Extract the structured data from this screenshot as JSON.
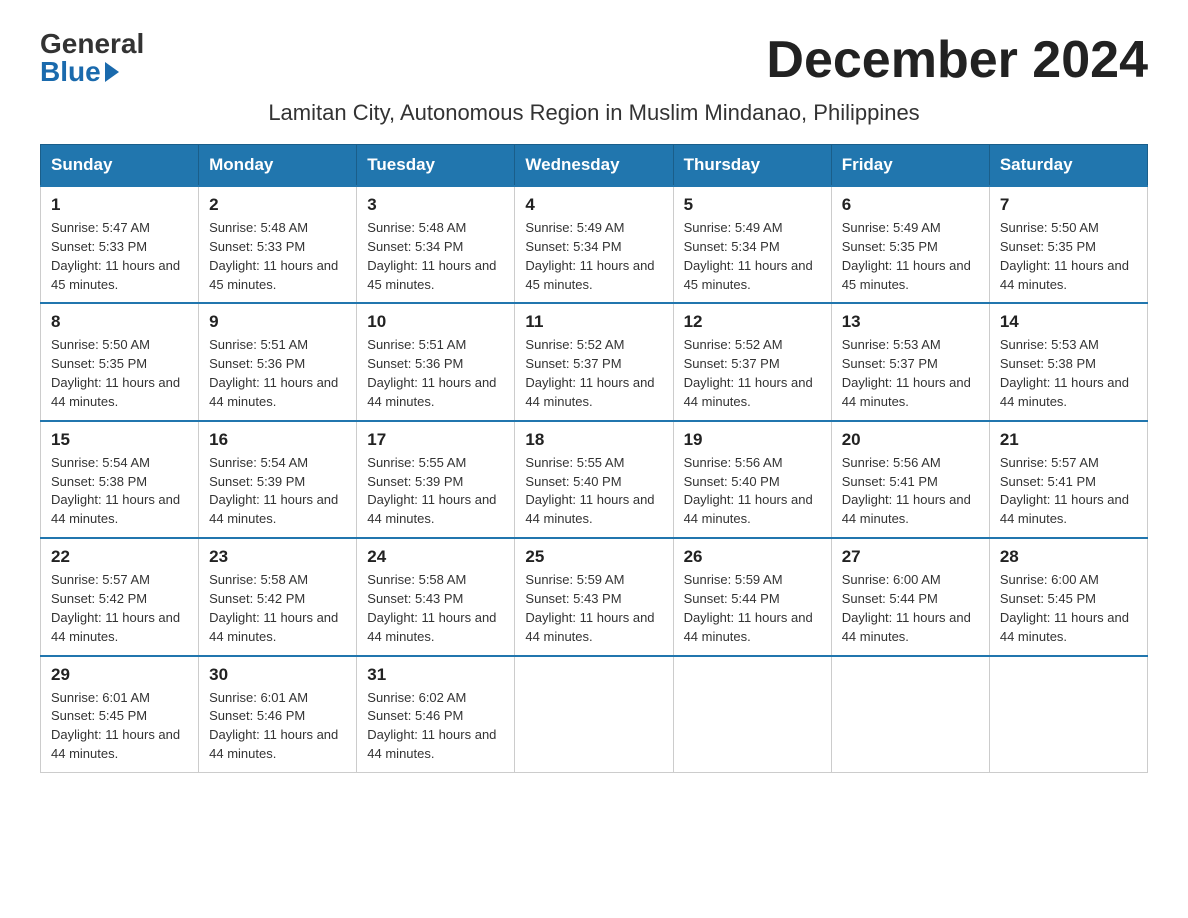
{
  "logo": {
    "general": "General",
    "blue": "Blue"
  },
  "title": "December 2024",
  "subtitle": "Lamitan City, Autonomous Region in Muslim Mindanao, Philippines",
  "weekdays": [
    "Sunday",
    "Monday",
    "Tuesday",
    "Wednesday",
    "Thursday",
    "Friday",
    "Saturday"
  ],
  "weeks": [
    [
      {
        "day": "1",
        "sunrise": "5:47 AM",
        "sunset": "5:33 PM",
        "daylight": "11 hours and 45 minutes."
      },
      {
        "day": "2",
        "sunrise": "5:48 AM",
        "sunset": "5:33 PM",
        "daylight": "11 hours and 45 minutes."
      },
      {
        "day": "3",
        "sunrise": "5:48 AM",
        "sunset": "5:34 PM",
        "daylight": "11 hours and 45 minutes."
      },
      {
        "day": "4",
        "sunrise": "5:49 AM",
        "sunset": "5:34 PM",
        "daylight": "11 hours and 45 minutes."
      },
      {
        "day": "5",
        "sunrise": "5:49 AM",
        "sunset": "5:34 PM",
        "daylight": "11 hours and 45 minutes."
      },
      {
        "day": "6",
        "sunrise": "5:49 AM",
        "sunset": "5:35 PM",
        "daylight": "11 hours and 45 minutes."
      },
      {
        "day": "7",
        "sunrise": "5:50 AM",
        "sunset": "5:35 PM",
        "daylight": "11 hours and 44 minutes."
      }
    ],
    [
      {
        "day": "8",
        "sunrise": "5:50 AM",
        "sunset": "5:35 PM",
        "daylight": "11 hours and 44 minutes."
      },
      {
        "day": "9",
        "sunrise": "5:51 AM",
        "sunset": "5:36 PM",
        "daylight": "11 hours and 44 minutes."
      },
      {
        "day": "10",
        "sunrise": "5:51 AM",
        "sunset": "5:36 PM",
        "daylight": "11 hours and 44 minutes."
      },
      {
        "day": "11",
        "sunrise": "5:52 AM",
        "sunset": "5:37 PM",
        "daylight": "11 hours and 44 minutes."
      },
      {
        "day": "12",
        "sunrise": "5:52 AM",
        "sunset": "5:37 PM",
        "daylight": "11 hours and 44 minutes."
      },
      {
        "day": "13",
        "sunrise": "5:53 AM",
        "sunset": "5:37 PM",
        "daylight": "11 hours and 44 minutes."
      },
      {
        "day": "14",
        "sunrise": "5:53 AM",
        "sunset": "5:38 PM",
        "daylight": "11 hours and 44 minutes."
      }
    ],
    [
      {
        "day": "15",
        "sunrise": "5:54 AM",
        "sunset": "5:38 PM",
        "daylight": "11 hours and 44 minutes."
      },
      {
        "day": "16",
        "sunrise": "5:54 AM",
        "sunset": "5:39 PM",
        "daylight": "11 hours and 44 minutes."
      },
      {
        "day": "17",
        "sunrise": "5:55 AM",
        "sunset": "5:39 PM",
        "daylight": "11 hours and 44 minutes."
      },
      {
        "day": "18",
        "sunrise": "5:55 AM",
        "sunset": "5:40 PM",
        "daylight": "11 hours and 44 minutes."
      },
      {
        "day": "19",
        "sunrise": "5:56 AM",
        "sunset": "5:40 PM",
        "daylight": "11 hours and 44 minutes."
      },
      {
        "day": "20",
        "sunrise": "5:56 AM",
        "sunset": "5:41 PM",
        "daylight": "11 hours and 44 minutes."
      },
      {
        "day": "21",
        "sunrise": "5:57 AM",
        "sunset": "5:41 PM",
        "daylight": "11 hours and 44 minutes."
      }
    ],
    [
      {
        "day": "22",
        "sunrise": "5:57 AM",
        "sunset": "5:42 PM",
        "daylight": "11 hours and 44 minutes."
      },
      {
        "day": "23",
        "sunrise": "5:58 AM",
        "sunset": "5:42 PM",
        "daylight": "11 hours and 44 minutes."
      },
      {
        "day": "24",
        "sunrise": "5:58 AM",
        "sunset": "5:43 PM",
        "daylight": "11 hours and 44 minutes."
      },
      {
        "day": "25",
        "sunrise": "5:59 AM",
        "sunset": "5:43 PM",
        "daylight": "11 hours and 44 minutes."
      },
      {
        "day": "26",
        "sunrise": "5:59 AM",
        "sunset": "5:44 PM",
        "daylight": "11 hours and 44 minutes."
      },
      {
        "day": "27",
        "sunrise": "6:00 AM",
        "sunset": "5:44 PM",
        "daylight": "11 hours and 44 minutes."
      },
      {
        "day": "28",
        "sunrise": "6:00 AM",
        "sunset": "5:45 PM",
        "daylight": "11 hours and 44 minutes."
      }
    ],
    [
      {
        "day": "29",
        "sunrise": "6:01 AM",
        "sunset": "5:45 PM",
        "daylight": "11 hours and 44 minutes."
      },
      {
        "day": "30",
        "sunrise": "6:01 AM",
        "sunset": "5:46 PM",
        "daylight": "11 hours and 44 minutes."
      },
      {
        "day": "31",
        "sunrise": "6:02 AM",
        "sunset": "5:46 PM",
        "daylight": "11 hours and 44 minutes."
      },
      null,
      null,
      null,
      null
    ]
  ],
  "labels": {
    "sunrise": "Sunrise:",
    "sunset": "Sunset:",
    "daylight": "Daylight:"
  }
}
